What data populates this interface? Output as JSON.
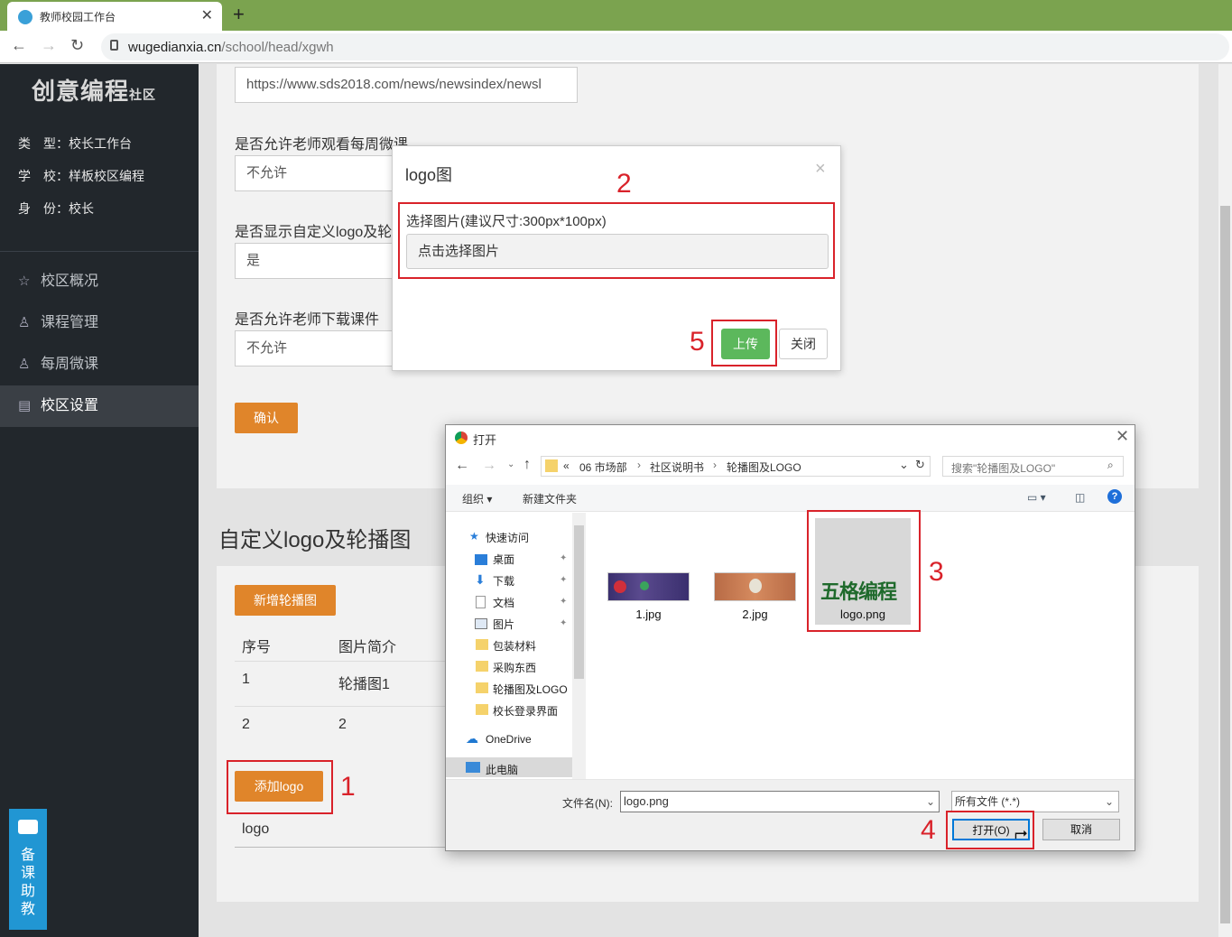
{
  "browser": {
    "tab_title": "教师校园工作台",
    "url_host": "wugedianxia.cn",
    "url_path": "/school/head/xgwh"
  },
  "sidebar": {
    "logo_main": "创意编程",
    "logo_sub": "社区",
    "type_line": "类　型：校长工作台",
    "school_line": "学　校：样板校区编程",
    "role_line": "身　份：校长",
    "menu": [
      {
        "label": "校区概况"
      },
      {
        "label": "课程管理"
      },
      {
        "label": "每周微课"
      },
      {
        "label": "校区设置"
      }
    ]
  },
  "settings": {
    "url_value": "https://www.sds2018.com/news/newsindex/newsl",
    "q1": "是否允许老师观看每周微课",
    "a1": "不允许",
    "q2": "是否显示自定义logo及轮",
    "a2": "是",
    "q3": "是否允许老师下载课件",
    "a3": "不允许",
    "confirm": "确认"
  },
  "custom": {
    "title": "自定义logo及轮播图",
    "add_carousel": "新增轮播图",
    "col_index": "序号",
    "col_desc": "图片简介",
    "rows": [
      {
        "index": "1",
        "desc": "轮播图1"
      },
      {
        "index": "2",
        "desc": "2"
      }
    ],
    "add_logo": "添加logo",
    "logo_label": "logo"
  },
  "modal": {
    "title": "logo图",
    "close": "×",
    "field_label": "选择图片(建议尺寸:300px*100px)",
    "field_placeholder": "点击选择图片",
    "upload": "上传",
    "close_btn": "关闭"
  },
  "dialog": {
    "title": "打开",
    "path": [
      "«",
      "06 市场部",
      "社区说明书",
      "轮播图及LOGO"
    ],
    "search_placeholder": "搜索\"轮播图及LOGO\"",
    "organize": "组织",
    "new_folder": "新建文件夹",
    "tree": [
      "快速访问",
      "桌面",
      "下载",
      "文档",
      "图片",
      "包装材料",
      "采购东西",
      "轮播图及LOGO",
      "校长登录界面",
      "OneDrive",
      "此电脑"
    ],
    "files": [
      "1.jpg",
      "2.jpg",
      "logo.png"
    ],
    "logo_thumb_text": "五格编程",
    "filename_label": "文件名(N):",
    "filename_value": "logo.png",
    "filter": "所有文件 (*.*)",
    "open": "打开(O)",
    "cancel": "取消"
  },
  "annotations": [
    "1",
    "2",
    "3",
    "4",
    "5"
  ],
  "helper": {
    "icon": "chat-icon",
    "text": "备课助教"
  },
  "colors": {
    "accent": "#e0852a",
    "sidebar": "#22272c",
    "tabbar": "#7ba34f",
    "upload": "#5cb85c",
    "annotation": "#d9222a"
  }
}
